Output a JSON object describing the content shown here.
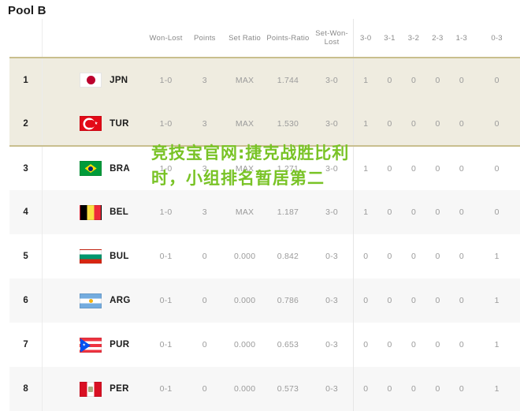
{
  "page": {
    "title": "Pool B"
  },
  "watermark": {
    "text": "竞技宝官网:捷克战胜比利时，小组排名暂居第二",
    "color": "#79c326"
  },
  "theme": {
    "qualified_row_bg": "#efece0",
    "qualified_border": "#c9bf8e",
    "alt_row_bg": "#f7f7f7",
    "plain_row_bg": "#ffffff",
    "header_text": "#8a8a8a",
    "data_text": "#9b9b9b",
    "team_text": "#1b1b1b"
  },
  "table": {
    "headers": {
      "rank": "",
      "team": "",
      "won_lost": "Won-Lost",
      "points": "Points",
      "set_ratio": "Set Ratio",
      "points_ratio": "Points-Ratio",
      "set_won_lost": "Set-Won-Lost",
      "r30": "3-0",
      "r31": "3-1",
      "r32": "3-2",
      "r23": "2-3",
      "r13": "1-3",
      "r03": "0-3"
    },
    "rows": [
      {
        "rank": "1",
        "flag": "jpn-flag",
        "team": "JPN",
        "won_lost": "1-0",
        "points": "3",
        "set_ratio": "MAX",
        "points_ratio": "1.744",
        "set_won_lost": "3-0",
        "r30": "1",
        "r31": "0",
        "r32": "0",
        "r23": "0",
        "r13": "0",
        "r03": "0",
        "style": "qualified"
      },
      {
        "rank": "2",
        "flag": "tur-flag",
        "team": "TUR",
        "won_lost": "1-0",
        "points": "3",
        "set_ratio": "MAX",
        "points_ratio": "1.530",
        "set_won_lost": "3-0",
        "r30": "1",
        "r31": "0",
        "r32": "0",
        "r23": "0",
        "r13": "0",
        "r03": "0",
        "style": "qualified last-qualified"
      },
      {
        "rank": "3",
        "flag": "bra-flag",
        "team": "BRA",
        "won_lost": "1-0",
        "points": "3",
        "set_ratio": "MAX",
        "points_ratio": "1.271",
        "set_won_lost": "3-0",
        "r30": "1",
        "r31": "0",
        "r32": "0",
        "r23": "0",
        "r13": "0",
        "r03": "0",
        "style": "plain"
      },
      {
        "rank": "4",
        "flag": "bel-flag",
        "team": "BEL",
        "won_lost": "1-0",
        "points": "3",
        "set_ratio": "MAX",
        "points_ratio": "1.187",
        "set_won_lost": "3-0",
        "r30": "1",
        "r31": "0",
        "r32": "0",
        "r23": "0",
        "r13": "0",
        "r03": "0",
        "style": "alt"
      },
      {
        "rank": "5",
        "flag": "bul-flag",
        "team": "BUL",
        "won_lost": "0-1",
        "points": "0",
        "set_ratio": "0.000",
        "points_ratio": "0.842",
        "set_won_lost": "0-3",
        "r30": "0",
        "r31": "0",
        "r32": "0",
        "r23": "0",
        "r13": "0",
        "r03": "1",
        "style": "plain"
      },
      {
        "rank": "6",
        "flag": "arg-flag",
        "team": "ARG",
        "won_lost": "0-1",
        "points": "0",
        "set_ratio": "0.000",
        "points_ratio": "0.786",
        "set_won_lost": "0-3",
        "r30": "0",
        "r31": "0",
        "r32": "0",
        "r23": "0",
        "r13": "0",
        "r03": "1",
        "style": "alt"
      },
      {
        "rank": "7",
        "flag": "pur-flag",
        "team": "PUR",
        "won_lost": "0-1",
        "points": "0",
        "set_ratio": "0.000",
        "points_ratio": "0.653",
        "set_won_lost": "0-3",
        "r30": "0",
        "r31": "0",
        "r32": "0",
        "r23": "0",
        "r13": "0",
        "r03": "1",
        "style": "plain"
      },
      {
        "rank": "8",
        "flag": "per-flag",
        "team": "PER",
        "won_lost": "0-1",
        "points": "0",
        "set_ratio": "0.000",
        "points_ratio": "0.573",
        "set_won_lost": "0-3",
        "r30": "0",
        "r31": "0",
        "r32": "0",
        "r23": "0",
        "r13": "0",
        "r03": "1",
        "style": "alt"
      }
    ]
  }
}
